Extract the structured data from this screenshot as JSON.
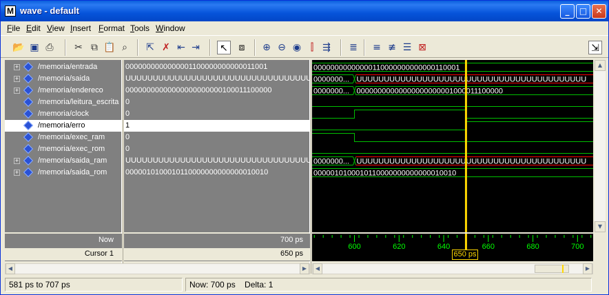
{
  "window": {
    "title": "wave - default",
    "app_icon_letter": "M"
  },
  "titlebar_buttons": {
    "minimize": "_",
    "maximize": "□",
    "close": "✕"
  },
  "menu": [
    {
      "label": "File",
      "u": "F",
      "rest": "ile"
    },
    {
      "label": "Edit",
      "u": "E",
      "rest": "dit"
    },
    {
      "label": "View",
      "u": "V",
      "rest": "iew"
    },
    {
      "label": "Insert",
      "u": "I",
      "rest": "nsert"
    },
    {
      "label": "Format",
      "u": "F",
      "rest": "ormat"
    },
    {
      "label": "Tools",
      "u": "T",
      "rest": "ools"
    },
    {
      "label": "Window",
      "u": "W",
      "rest": "indow"
    }
  ],
  "toolbar": {
    "icons": [
      "open-icon",
      "save-icon",
      "print-icon",
      "cut-icon",
      "copy-icon",
      "paste-icon",
      "find-icon",
      "select-icon",
      "delete-icon",
      "prev-transition-icon",
      "next-transition-icon",
      "pointer-icon",
      "zoom-mode-icon",
      "zoom-in-icon",
      "zoom-out-icon",
      "zoom-full-icon",
      "insert-cursor-icon",
      "find-next-icon",
      "wave-format-icon",
      "wave-group-icon",
      "wave-expand-icon",
      "wave-collapse-icon",
      "wave-remove-icon",
      "dock-icon"
    ]
  },
  "signals": [
    {
      "name": "/memoria/entrada",
      "value": "000000000000000110000000000001100​1",
      "expandable": true,
      "wave_value": "00000000000000110000000000000110001"
    },
    {
      "name": "/memoria/saida",
      "value": "UUUUUUUUUUUUUUUUUUUUUUUUUUUUUUUUUUUU",
      "expandable": true,
      "wave_first": "0000000...",
      "wave_second": "UUUUUUUUUUUUUUUUUUUUUUUUUUUUUUUUUUUUUUUUUU"
    },
    {
      "name": "/memoria/endereco",
      "value": "00000000000000000000000100011100000",
      "expandable": true,
      "wave_first": "0000000...",
      "wave_second": "00000000000000000000001000011100000"
    },
    {
      "name": "/memoria/leitura_escrita",
      "value": "0",
      "expandable": false
    },
    {
      "name": "/memoria/clock",
      "value": "0",
      "expandable": false
    },
    {
      "name": "/memoria/erro",
      "value": "1",
      "expandable": false,
      "selected": true
    },
    {
      "name": "/memoria/exec_ram",
      "value": "0",
      "expandable": false
    },
    {
      "name": "/memoria/exec_rom",
      "value": "0",
      "expandable": false
    },
    {
      "name": "/memoria/saida_ram",
      "value": "UUUUUUUUUUUUUUUUUUUUUUUUUUUUUUUUUUUU",
      "expandable": true,
      "wave_first": "0000000...",
      "wave_second": "UUUUUUUUUUUUUUUUUUUUUUUUUUUUUUUUUUUUUUUUUU"
    },
    {
      "name": "/memoria/saida_rom",
      "value": "0000010100010110000000000000010010",
      "expandable": true,
      "wave_value": "0000010100010110000000000000010010"
    }
  ],
  "now": {
    "label": "Now",
    "value": "700 ps"
  },
  "cursor": {
    "label": "Cursor 1",
    "value": "650 ps",
    "marker": "650 ps"
  },
  "ruler": {
    "ticks": [
      "600",
      "620",
      "640",
      "660",
      "680",
      "700"
    ]
  },
  "status": {
    "range": "581 ps to 707 ps",
    "now": "Now: 700 ps",
    "delta": "Delta: 1"
  },
  "colors": {
    "wave_green": "#00c000",
    "wave_red": "#ff0000",
    "cursor_yellow": "#ffd700",
    "ruler_green": "#00ff00"
  }
}
